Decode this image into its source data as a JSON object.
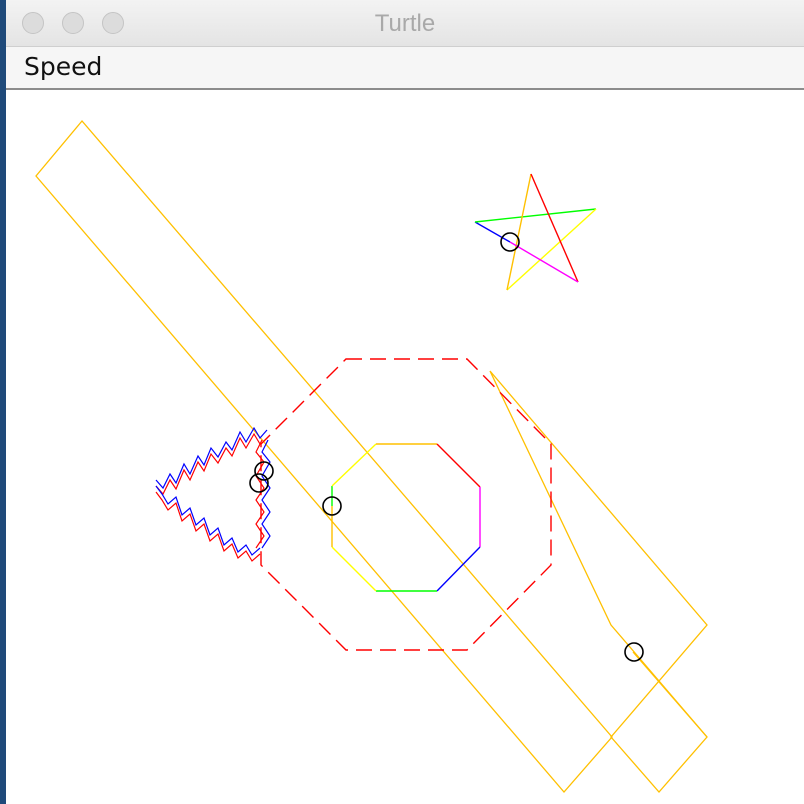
{
  "window": {
    "title": "Turtle"
  },
  "menu": {
    "items": [
      {
        "label": "Speed"
      }
    ]
  },
  "colors": {
    "orange": "#ffc000",
    "red": "#ff0000",
    "blue": "#0000ff",
    "green": "#00ff00",
    "yellow": "#ffff00",
    "magenta": "#ff00ff",
    "cursor": "#000000"
  },
  "drawing": {
    "shapes": [
      "long-rectangle",
      "tilted-rectangle",
      "dashed-octagon",
      "octagon",
      "star",
      "zigzag-chevron"
    ],
    "turtle_cursor_count": 5
  }
}
